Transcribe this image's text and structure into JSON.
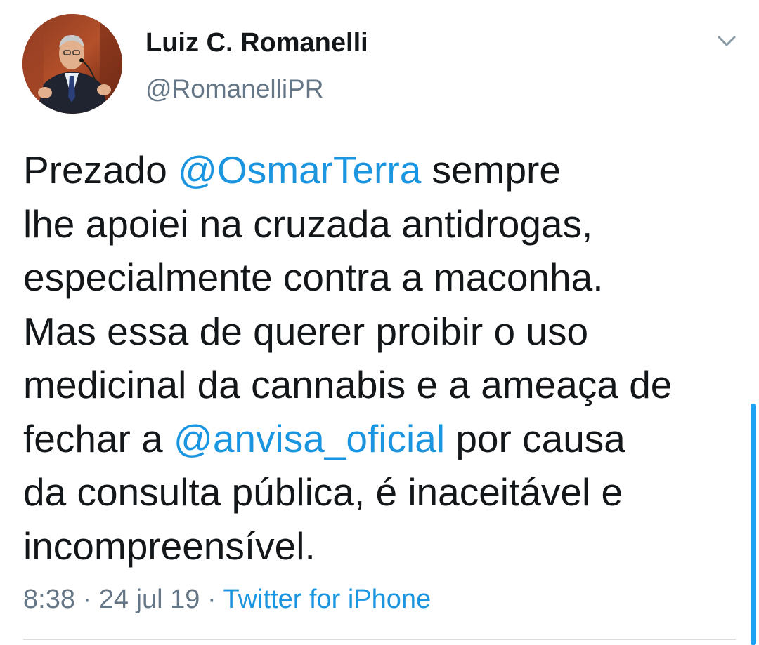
{
  "tweet": {
    "author": {
      "display_name": "Luiz C. Romanelli",
      "handle": "@RomanelliPR"
    },
    "text_lines": [
      [
        {
          "text": "Prezado ",
          "type": "text"
        },
        {
          "text": "@OsmarTerra",
          "type": "mention"
        },
        {
          "text": " sempre",
          "type": "text"
        }
      ],
      [
        {
          "text": "lhe apoiei na cruzada antidrogas,",
          "type": "text"
        }
      ],
      [
        {
          "text": "especialmente contra a maconha.",
          "type": "text"
        }
      ],
      [
        {
          "text": "Mas essa de querer proibir o uso",
          "type": "text"
        }
      ],
      [
        {
          "text": "medicinal da cannabis e a ameaça de",
          "type": "text"
        }
      ],
      [
        {
          "text": "fechar a ",
          "type": "text"
        },
        {
          "text": "@anvisa_oficial",
          "type": "mention"
        },
        {
          "text": " por causa",
          "type": "text"
        }
      ],
      [
        {
          "text": "da consulta pública, é inaceitável e",
          "type": "text"
        }
      ],
      [
        {
          "text": "incompreensível.",
          "type": "text"
        }
      ]
    ],
    "meta": {
      "time": "8:38",
      "separator": " · ",
      "date": "24 jul 19",
      "source": "Twitter for iPhone"
    }
  },
  "icons": {
    "menu": "chevron-down-icon",
    "avatar": "avatar-photo"
  },
  "colors": {
    "text": "#14171a",
    "secondary": "#657786",
    "link": "#1b95e0",
    "divider": "#d8dde1",
    "scroll": "#1da1f2"
  }
}
